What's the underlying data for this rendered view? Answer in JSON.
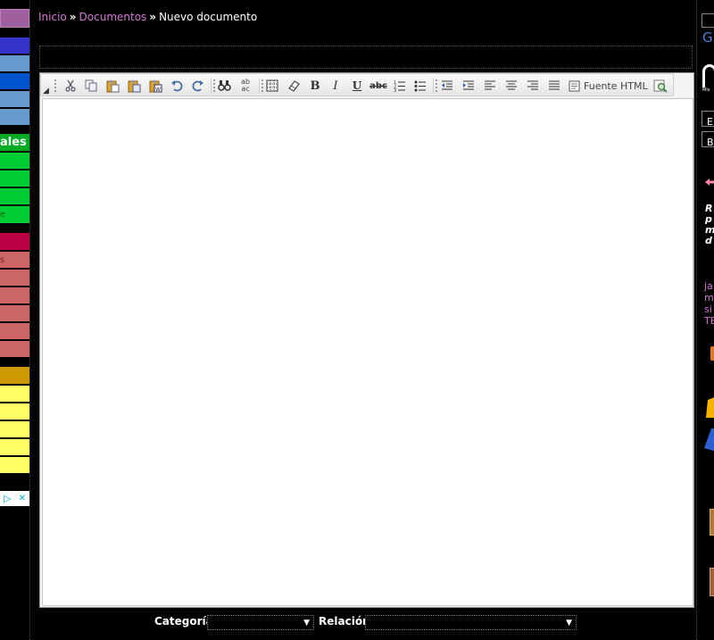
{
  "breadcrumb": {
    "home": "Inicio",
    "separator1": "»",
    "documents": "Documentos",
    "separator2": "»",
    "current": "Nuevo documento"
  },
  "left_sidebar": {
    "fragment_green_header": "ales",
    "fragment_green_item": "e",
    "fragment_red_item": "s"
  },
  "ad_choices": {
    "play_glyph": "▷",
    "close_glyph": "✕"
  },
  "toolbar": {
    "collapse_glyph": "◢",
    "bold_label": "B",
    "italic_label": "I",
    "underline_label": "U",
    "strike_label": "abc",
    "replace_label": "ab\nac",
    "source_label": "Fuente HTML"
  },
  "form": {
    "category_label": "Categoría",
    "category_arrow": "▼",
    "relation_label": "Relación",
    "relation_arrow": "▼"
  },
  "right_sidebar": {
    "top_letter": "G",
    "logo_caption": "Mis",
    "button1": "E",
    "button2": "B",
    "italic_lines": [
      "R",
      "p",
      "m",
      "d"
    ],
    "link_lines": [
      "ja",
      "m",
      "si",
      "TE"
    ]
  },
  "colors": {
    "link": "#d27ad2",
    "background": "#000000",
    "sidebar_blue": "#6699cc",
    "sidebar_green": "#00cc33",
    "sidebar_red": "#cc6666",
    "sidebar_yellow": "#ffff66"
  }
}
